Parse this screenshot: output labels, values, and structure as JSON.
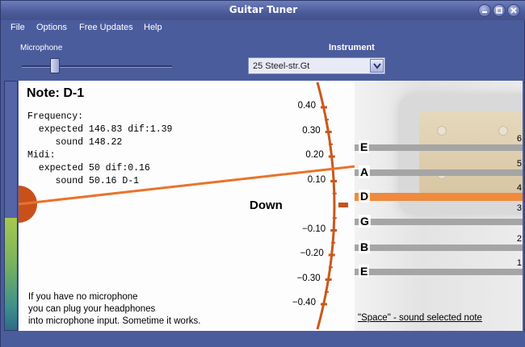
{
  "window": {
    "title": "Guitar Tuner"
  },
  "menu": [
    "File",
    "Options",
    "Free Updates",
    "Help"
  ],
  "microphone": {
    "label": "Microphone",
    "level": 0.22
  },
  "instrument": {
    "label": "Instrument",
    "selected": "25 Steel-str.Gt"
  },
  "meter": {
    "level": 0.45
  },
  "note": {
    "title": "Note: D-1",
    "frequency_label": "Frequency:",
    "frequency_expected": "  expected 146.83 dif:1.39",
    "frequency_sound": "     sound 148.22",
    "midi_label": "Midi:",
    "midi_expected": "  expected 50 dif:0.16",
    "midi_sound": "     sound 50.16 D-1"
  },
  "help_lines": [
    "If you have no microphone",
    "you can plug your headphones",
    "into microphone input. Sometime it works."
  ],
  "dial": {
    "direction": "Down",
    "ticks": [
      "0.40",
      "0.30",
      "0.20",
      "0.10",
      "−0.10",
      "−0.20",
      "−0.30",
      "−0.40"
    ],
    "needle_value": 0.16,
    "accent": "#e8732a"
  },
  "strings": [
    {
      "letter": "E",
      "number": "6",
      "selected": false
    },
    {
      "letter": "A",
      "number": "5",
      "selected": false
    },
    {
      "letter": "D",
      "number": "4",
      "selected": true
    },
    {
      "letter": "G",
      "number": "3",
      "selected": false
    },
    {
      "letter": "B",
      "number": "2",
      "selected": false
    },
    {
      "letter": "E",
      "number": "1",
      "selected": false
    }
  ],
  "string_hint": "\"Space\" - sound selected note"
}
